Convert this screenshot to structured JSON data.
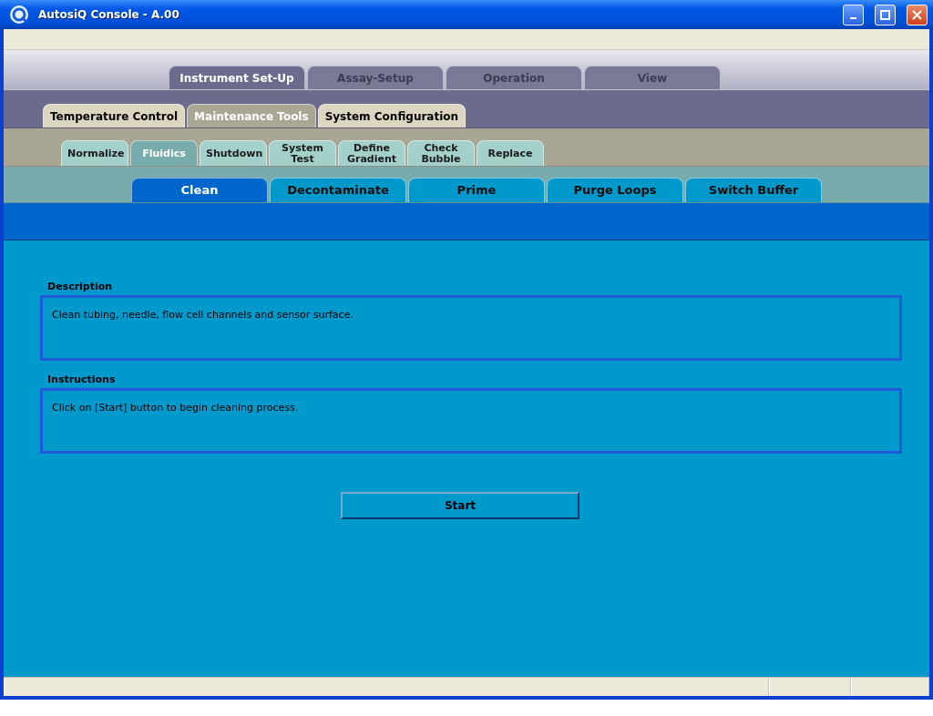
{
  "window": {
    "title": "AutosiQ Console - A.00"
  },
  "tab_rows": [
    {
      "tabs": [
        {
          "label": "Instrument Set-Up",
          "selected": true
        },
        {
          "label": "Assay-Setup",
          "selected": false
        },
        {
          "label": "Operation",
          "selected": false
        },
        {
          "label": "View",
          "selected": false
        }
      ]
    },
    {
      "tabs": [
        {
          "label": "Temperature Control",
          "selected": false
        },
        {
          "label": "Maintenance Tools",
          "selected": true
        },
        {
          "label": "System Configuration",
          "selected": false
        }
      ]
    },
    {
      "tabs": [
        {
          "label": "Normalize",
          "selected": false
        },
        {
          "label": "Fluidics",
          "selected": true
        },
        {
          "label": "Shutdown",
          "selected": false
        },
        {
          "label": "System Test",
          "selected": false
        },
        {
          "label": "Define Gradient",
          "selected": false
        },
        {
          "label": "Check Bubble",
          "selected": false
        },
        {
          "label": "Replace",
          "selected": false
        }
      ]
    },
    {
      "tabs": [
        {
          "label": "Clean",
          "selected": true
        },
        {
          "label": "Decontaminate",
          "selected": false
        },
        {
          "label": "Prime",
          "selected": false
        },
        {
          "label": "Purge Loops",
          "selected": false
        },
        {
          "label": "Switch Buffer",
          "selected": false
        }
      ]
    }
  ],
  "sections": [
    {
      "heading": "Description",
      "text": "Clean tubing, needle, flow cell channels and sensor surface."
    },
    {
      "heading": "Instructions",
      "text": "Click on [Start] button to begin cleaning process."
    }
  ],
  "start_button": "Start"
}
